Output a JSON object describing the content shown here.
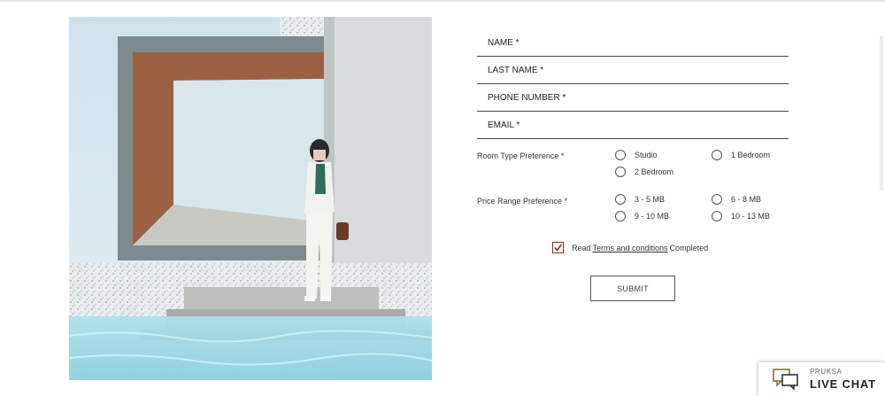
{
  "form": {
    "fields": [
      {
        "placeholder": "NAME *",
        "value": ""
      },
      {
        "placeholder": "LAST NAME *",
        "value": ""
      },
      {
        "placeholder": "PHONE NUMBER *",
        "value": ""
      },
      {
        "placeholder": "EMAIL *",
        "value": ""
      }
    ],
    "room_type": {
      "label": "Room Type Preference *",
      "options": [
        "Studio",
        "1 Bedroom",
        "2 Bedroom"
      ]
    },
    "price_range": {
      "label": "Price Range Preference *",
      "options": [
        "3 - 5 MB",
        "6 - 8 MB",
        "9 - 10 MB",
        "10 - 13 MB"
      ]
    },
    "terms": {
      "prefix": "Read",
      "link": "Terms and conditions",
      "suffix": "Completed",
      "checked": true
    },
    "submit_label": "SUBMIT"
  },
  "live_chat": {
    "brand": "PRUKSA",
    "title": "LIVE CHAT"
  },
  "colors": {
    "accent": "#8d2b2b",
    "line": "#444444",
    "text": "#333333"
  },
  "icons": {
    "check": "check-icon",
    "chat": "chat-bubbles-icon"
  }
}
